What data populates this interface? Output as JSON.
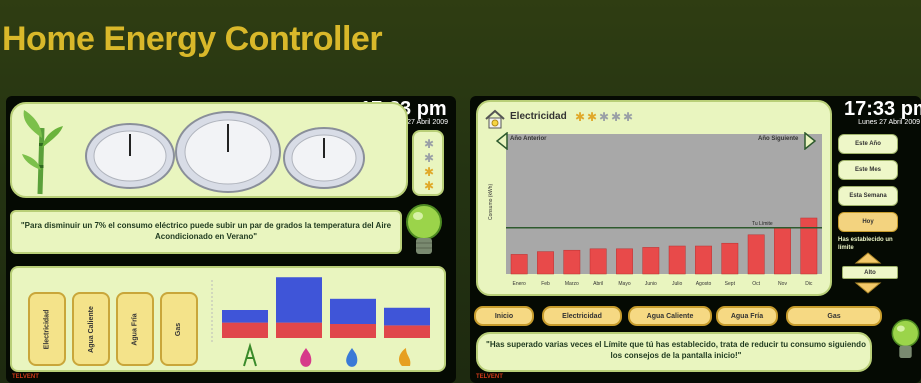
{
  "header": {
    "title": "Home Energy Controller"
  },
  "left": {
    "time": "17:33 pm",
    "date": "Lunes 27 Abril 2009",
    "tip": "\"Para disminuir un 7% el consumo eléctrico puede subir un par de grados la temperatura del Aire Acondicionado en Verano\"",
    "tabs": [
      "Electricidad",
      "Agua Caliente",
      "Agua Fría",
      "Gas"
    ],
    "mini_chart": {
      "red": [
        0.55,
        0.55,
        0.5,
        0.45
      ],
      "blue": [
        0.25,
        0.9,
        0.5,
        0.35
      ],
      "colors": {
        "red": "#e0474a",
        "blue": "#3f55d8"
      }
    },
    "footer": "TELVENT"
  },
  "right": {
    "time": "17:33 pm",
    "date": "Lunes 27 Abril 2009",
    "chart_title": "Electricidad",
    "nav_prev": "Año Anterior",
    "nav_next": "Año Siguiente",
    "ylabel": "Consumo (kWh)",
    "limit_label": "Tu Límite",
    "months": [
      "Enero",
      "Feb",
      "Marzo",
      "Abril",
      "Mayo",
      "Junio",
      "Julio",
      "Agosto",
      "Sept",
      "Oct",
      "Nov",
      "Dic"
    ],
    "side_buttons": [
      "Este Año",
      "Este Mes",
      "Esta Semana",
      "Hoy"
    ],
    "limit_text": "Has establecido un límite",
    "limit_value": "Alto",
    "buttons": [
      "Inicio",
      "Electricidad",
      "Agua Caliente",
      "Agua Fría",
      "Gas"
    ],
    "message": "\"Has superado varias veces el Límite que tú has establecido, trata de reducir tu consumo siguiendo los consejos de la pantalla inicio!\"",
    "footer": "TELVENT"
  },
  "chart_data": {
    "type": "bar",
    "title": "Electricidad",
    "ylabel": "Consumo (kWh)",
    "categories": [
      "Enero",
      "Feb",
      "Marzo",
      "Abril",
      "Mayo",
      "Junio",
      "Julio",
      "Agosto",
      "Sept",
      "Oct",
      "Nov",
      "Dic"
    ],
    "values": [
      14,
      16,
      17,
      18,
      18,
      19,
      20,
      20,
      22,
      28,
      33,
      40
    ],
    "limit": 33,
    "ylim": [
      0,
      100
    ],
    "colors": {
      "bar": "#e84a4a",
      "plot_bg": "#a8a8a8",
      "limit": "#2e5a2e"
    }
  }
}
